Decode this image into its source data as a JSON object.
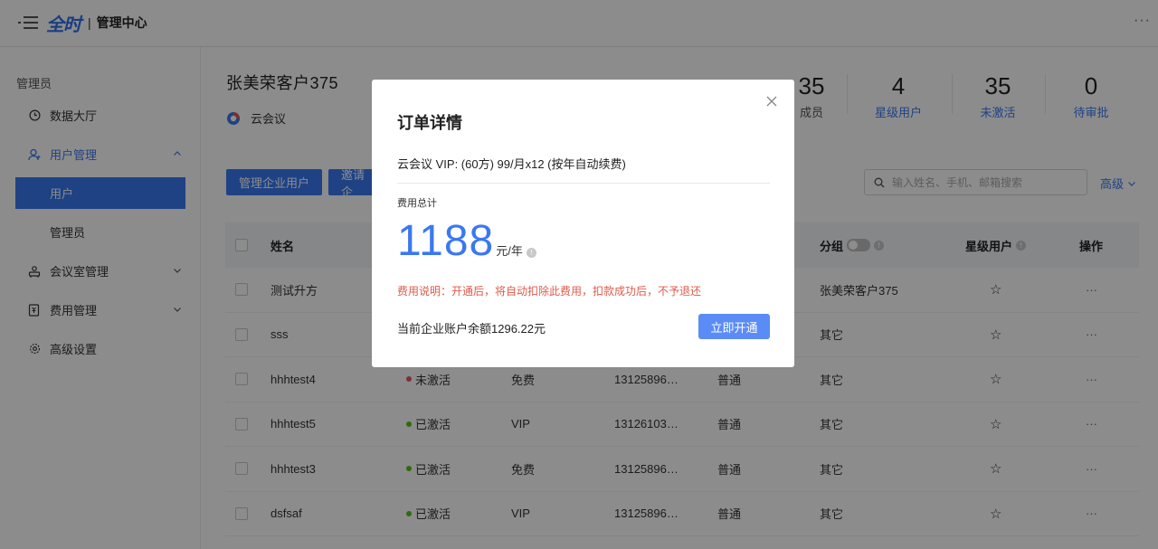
{
  "header": {
    "logo": "全时",
    "separator": "|",
    "title": "管理中心",
    "more": "···"
  },
  "sidebar": {
    "group_title": "管理员",
    "items": [
      {
        "label": "数据大厅",
        "icon": "clock-icon"
      },
      {
        "label": "用户管理",
        "icon": "user-icon",
        "expanded": true
      },
      {
        "label": "会议室管理",
        "icon": "meeting-room-icon"
      },
      {
        "label": "费用管理",
        "icon": "billing-icon"
      },
      {
        "label": "高级设置",
        "icon": "gear-icon"
      }
    ],
    "sub_items": [
      {
        "label": "用户",
        "active": true
      },
      {
        "label": "管理员",
        "active": false
      }
    ]
  },
  "main": {
    "company_name": "张美荣客户375",
    "product_name": "云会议",
    "stats": [
      {
        "value": "35",
        "label": "成员"
      },
      {
        "value": "4",
        "label": "星级用户"
      },
      {
        "value": "35",
        "label": "未激活"
      },
      {
        "value": "0",
        "label": "待审批"
      }
    ],
    "buttons": {
      "manage_enterprise_users": "管理企业用户",
      "invite": "邀请企"
    },
    "search_placeholder": "输入姓名、手机、邮箱搜索",
    "advanced": "高级"
  },
  "table": {
    "headers": {
      "name": "姓名",
      "group": "分组",
      "star_user": "星级用户",
      "action": "操作"
    },
    "rows": [
      {
        "name": "测试升方",
        "status": "",
        "plan": "",
        "phone": "",
        "type": "",
        "group": "张美荣客户375"
      },
      {
        "name": "sss",
        "status": "",
        "plan": "",
        "phone": "",
        "type": "",
        "group": "其它"
      },
      {
        "name": "hhhtest4",
        "status": "未激活",
        "status_color": "#e05a5a",
        "plan": "免费",
        "phone": "13125896…",
        "type": "普通",
        "group": "其它"
      },
      {
        "name": "hhhtest5",
        "status": "已激活",
        "status_color": "#52c41a",
        "plan": "VIP",
        "phone": "13126103…",
        "type": "普通",
        "group": "其它"
      },
      {
        "name": "hhhtest3",
        "status": "已激活",
        "status_color": "#52c41a",
        "plan": "免费",
        "phone": "13125896…",
        "type": "普通",
        "group": "其它"
      },
      {
        "name": "dsfsaf",
        "status": "已激活",
        "status_color": "#52c41a",
        "plan": "VIP",
        "phone": "13125896…",
        "type": "普通",
        "group": "其它"
      }
    ],
    "star_glyph": "☆",
    "action_glyph": "···"
  },
  "modal": {
    "title": "订单详情",
    "plan": "云会议 VIP: (60方) 99/月x12 (按年自动续费)",
    "total_label": "费用总计",
    "amount": "1188",
    "unit": "元/年",
    "note": "费用说明：开通后，将自动扣除此费用，扣款成功后，不予退还",
    "balance": "当前企业账户余额1296.22元",
    "confirm_button": "立即开通"
  },
  "colors": {
    "accent": "#3a78f2",
    "warning_text": "#e05a4b",
    "overlay": "rgba(0,0,0,0.45)"
  }
}
